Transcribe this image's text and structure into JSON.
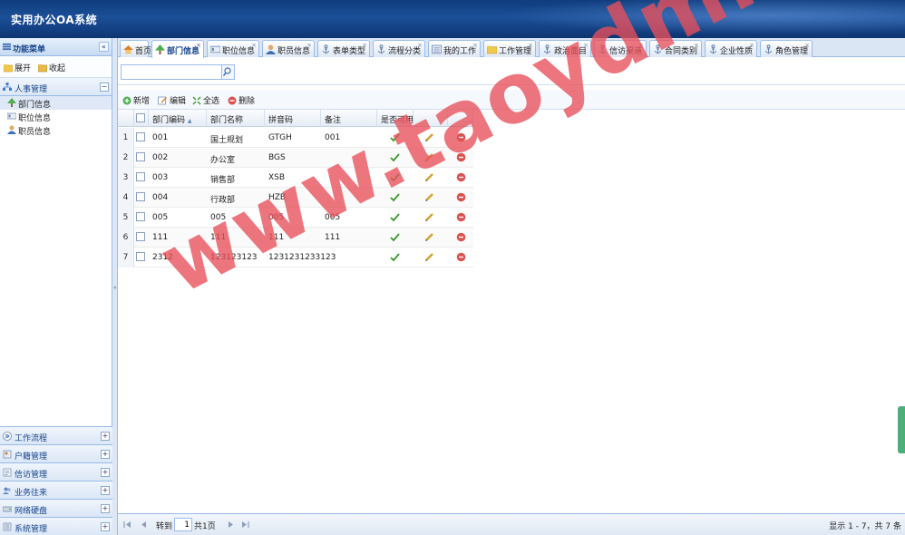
{
  "app": {
    "title": "实用办公OA系统"
  },
  "sidebar": {
    "header": "功能菜单",
    "collapse_glyph": "«",
    "expand_label": "展开",
    "collapse_label": "收起",
    "section": {
      "label": "人事管理",
      "toggle": "−"
    },
    "items": [
      {
        "label": "部门信息",
        "icon": "tree-icon"
      },
      {
        "label": "职位信息",
        "icon": "id-card-icon"
      },
      {
        "label": "职员信息",
        "icon": "user-icon"
      }
    ],
    "bottom_sections": [
      {
        "label": "工作流程",
        "toggle": "+"
      },
      {
        "label": "户籍管理",
        "toggle": "+"
      },
      {
        "label": "信访管理",
        "toggle": "+"
      },
      {
        "label": "业务往来",
        "toggle": "+"
      },
      {
        "label": "网络硬盘",
        "toggle": "+"
      },
      {
        "label": "系统管理",
        "toggle": "+"
      }
    ]
  },
  "tabs": [
    {
      "label": "首页",
      "closable": false
    },
    {
      "label": "部门信息",
      "closable": true,
      "active": true
    },
    {
      "label": "职位信息",
      "closable": true
    },
    {
      "label": "职员信息",
      "closable": true
    },
    {
      "label": "表单类型",
      "closable": true
    },
    {
      "label": "流程分类",
      "closable": true
    },
    {
      "label": "我的工作",
      "closable": true
    },
    {
      "label": "工作管理",
      "closable": true
    },
    {
      "label": "政治面目",
      "closable": true
    },
    {
      "label": "信访渠道",
      "closable": true
    },
    {
      "label": "合同类别",
      "closable": true
    },
    {
      "label": "企业性质",
      "closable": true
    },
    {
      "label": "角色管理",
      "closable": true
    }
  ],
  "toolbar": {
    "add": "新增",
    "edit": "编辑",
    "select_all": "全选",
    "delete": "删除"
  },
  "search": {
    "value": "",
    "placeholder": ""
  },
  "grid": {
    "headers": {
      "code": "部门编码",
      "name": "部门名称",
      "pinyin": "拼音码",
      "remark": "备注",
      "enabled": "是否可用"
    },
    "sort_glyph": "▲",
    "rows": [
      {
        "n": "1",
        "code": "001",
        "name": "国土规划",
        "pinyin": "GTGH",
        "remark": "001",
        "enabled": true
      },
      {
        "n": "2",
        "code": "002",
        "name": "办公室",
        "pinyin": "BGS",
        "remark": "",
        "enabled": true
      },
      {
        "n": "3",
        "code": "003",
        "name": "销售部",
        "pinyin": "XSB",
        "remark": "",
        "enabled": true
      },
      {
        "n": "4",
        "code": "004",
        "name": "行政部",
        "pinyin": "HZB",
        "remark": "",
        "enabled": true
      },
      {
        "n": "5",
        "code": "005",
        "name": "005",
        "pinyin": "005",
        "remark": "005",
        "enabled": true
      },
      {
        "n": "6",
        "code": "111",
        "name": "111",
        "pinyin": "111",
        "remark": "111",
        "enabled": true
      },
      {
        "n": "7",
        "code": "2312",
        "name": "123123123",
        "pinyin": "1231231233123",
        "remark": "",
        "enabled": true
      }
    ]
  },
  "pager": {
    "goto_label": "转到",
    "page_value": "1",
    "total_pages": "共1页",
    "summary": "显示 1 - 7，共 7 条"
  },
  "watermark": {
    "text": "www.taoydm.com"
  },
  "colors": {
    "header_bg": "#1b4f98",
    "border": "#99bbe8",
    "watermark": "#e8505a",
    "check": "#3a9a2a",
    "delete": "#d9534f"
  }
}
